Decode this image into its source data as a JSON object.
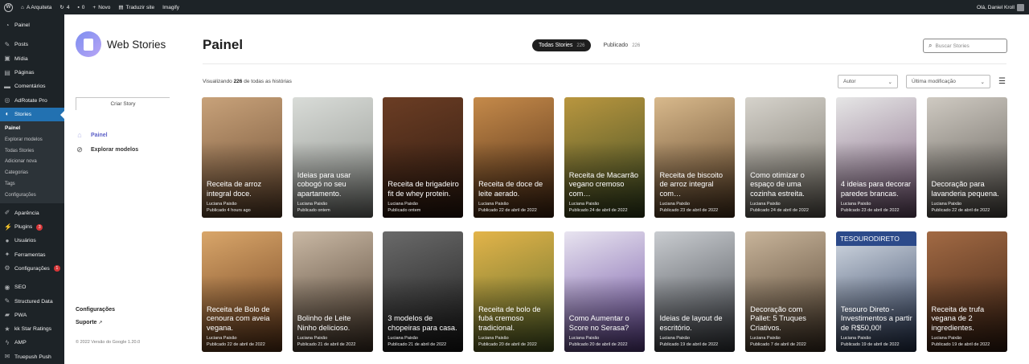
{
  "adminbar": {
    "site": "A Arquiteta",
    "updates": "4",
    "comments": "0",
    "new": "Novo",
    "translate": "Traduzir site",
    "imagify": "Imagify",
    "greeting": "Olá, Daniel Kroll"
  },
  "sidebar": {
    "items_top": [
      {
        "icon": "gauge",
        "label": "Painel"
      }
    ],
    "items_content": [
      {
        "icon": "pin",
        "label": "Posts"
      },
      {
        "icon": "media",
        "label": "Mídia"
      },
      {
        "icon": "page",
        "label": "Páginas"
      },
      {
        "icon": "comment",
        "label": "Comentários"
      },
      {
        "icon": "adrotate",
        "label": "AdRotate Pro"
      }
    ],
    "stories": {
      "label": "Stories",
      "sub": [
        "Painel",
        "Explorar modelos",
        "Todas Stories",
        "Adicionar nova",
        "Categorias",
        "Tags",
        "Configurações"
      ]
    },
    "items_bottom": [
      {
        "icon": "brush",
        "label": "Aparência"
      },
      {
        "icon": "plug",
        "label": "Plugins",
        "badge": "3"
      },
      {
        "icon": "user",
        "label": "Usuários"
      },
      {
        "icon": "wrench",
        "label": "Ferramentas"
      },
      {
        "icon": "settings",
        "label": "Configurações",
        "badge": "1"
      }
    ],
    "items_extra": [
      {
        "icon": "seo",
        "label": "SEO"
      },
      {
        "icon": "pin",
        "label": "Structured Data"
      },
      {
        "icon": "pwa",
        "label": "PWA"
      },
      {
        "icon": "star",
        "label": "kk Star Ratings"
      },
      {
        "icon": "amp",
        "label": "AMP"
      },
      {
        "icon": "push",
        "label": "Truepush Push"
      }
    ]
  },
  "ws_nav": {
    "brand": "Web Stories",
    "create": "Criar Story",
    "links": [
      {
        "label": "Painel",
        "icon": "home-icon"
      },
      {
        "label": "Explorar modelos",
        "icon": "compass-icon"
      }
    ],
    "settings": "Configurações",
    "support": "Suporte",
    "version": "© 2022 Versão do Google 1.20.0"
  },
  "header": {
    "title": "Painel",
    "tab_all": "Todas Stories",
    "tab_all_count": "226",
    "tab_pub": "Publicado",
    "tab_pub_count": "226",
    "search_placeholder": "Buscar Stories"
  },
  "toolbar": {
    "viewing_pre": "Visualizando",
    "viewing_count": "226",
    "viewing_post": "de todas as histórias",
    "author": "Autor",
    "sort": "Última modificação"
  },
  "stories": [
    {
      "title": "Receita de arroz integral doce.",
      "author": "Luciana Paixão",
      "date": "Publicado 4 hours ago",
      "bg": "#c8a27a",
      "bg2": "#6a4a30"
    },
    {
      "title": "Ideias para usar cobogó no seu apartamento.",
      "author": "Luciana Paixão",
      "date": "Publicado ontem",
      "bg": "#d9dcd8",
      "bg2": "#8a8d88"
    },
    {
      "title": "Receita de brigadeiro fit de whey protein.",
      "author": "Luciana Paixão",
      "date": "Publicado ontem",
      "bg": "#6b3d24",
      "bg2": "#2e1a10"
    },
    {
      "title": "Receita de doce de leite aerado.",
      "author": "Luciana Paixão",
      "date": "Publicado 22 de abril de 2022",
      "bg": "#c58a4a",
      "bg2": "#4a2a14"
    },
    {
      "title": "Receita de Macarrão vegano cremoso com…",
      "author": "Luciana Paixão",
      "date": "Publicado 24 de abril de 2022",
      "bg": "#b9963f",
      "bg2": "#3a4a22"
    },
    {
      "title": "Receita de biscoito de arroz integral com…",
      "author": "Luciana Paixão",
      "date": "Publicado 23 de abril de 2022",
      "bg": "#d8b98c",
      "bg2": "#5a3e24"
    },
    {
      "title": "Como otimizar o espaço de uma cozinha estreita.",
      "author": "Luciana Paixão",
      "date": "Publicado 24 de abril de 2022",
      "bg": "#d6d3cc",
      "bg2": "#6f6a60"
    },
    {
      "title": "4 ideias para decorar paredes brancas.",
      "author": "Luciana Paixão",
      "date": "Publicado 23 de abril de 2022",
      "bg": "#e6e6e6",
      "bg2": "#7a5a7a"
    },
    {
      "title": "Decoração para lavanderia pequena.",
      "author": "Luciana Paixão",
      "date": "Publicado 22 de abril de 2022",
      "bg": "#cfcac2",
      "bg2": "#5a5650"
    },
    {
      "title": "Receita de Bolo de cenoura com aveia vegana.",
      "author": "Luciana Paixão",
      "date": "Publicado 22 de abril de 2022",
      "bg": "#d9a66a",
      "bg2": "#6a3c1c"
    },
    {
      "title": "Bolinho de Leite Ninho delicioso.",
      "author": "Luciana Paixão",
      "date": "Publicado 21 de abril de 2022",
      "bg": "#c9b8a4",
      "bg2": "#4a3a2c"
    },
    {
      "title": "3 modelos de chopeiras para casa.",
      "author": "Luciana Paixão",
      "date": "Publicado 21 de abril de 2022",
      "bg": "#6a6a6a",
      "bg2": "#1a1a1a"
    },
    {
      "title": "Receita de bolo de fubá cremoso tradicional.",
      "author": "Luciana Paixão",
      "date": "Publicado 20 de abril de 2022",
      "bg": "#e3b44a",
      "bg2": "#5a6a2a"
    },
    {
      "title": "Como Aumentar o Score no Serasa?",
      "author": "Luciana Paixão",
      "date": "Publicado 20 de abril de 2022",
      "bg": "#e8e4f0",
      "bg2": "#6a4aa0"
    },
    {
      "title": "Ideias de layout de escritório.",
      "author": "Luciana Paixão",
      "date": "Publicado 19 de abril de 2022",
      "bg": "#c9ccd0",
      "bg2": "#3e4248"
    },
    {
      "title": "Decoração com Pallet: 5 Truques Criativos.",
      "author": "Luciana Paixão",
      "date": "Publicado 7 de abril de 2022",
      "bg": "#c8b49a",
      "bg2": "#4a3a2a"
    },
    {
      "title": "Tesouro Direto - Investimentos a partir de R$50,00!",
      "author": "Luciana Paixão",
      "date": "Publicado 19 de abril de 2022",
      "bg": "#d6dde6",
      "bg2": "#2a3a5a",
      "banner": "TESOURODIRETO"
    },
    {
      "title": "Receita de trufa vegana de 2 ingredientes.",
      "author": "Luciana Paixão",
      "date": "Publicado 19 de abril de 2022",
      "bg": "#a26a44",
      "bg2": "#3a2012"
    }
  ]
}
